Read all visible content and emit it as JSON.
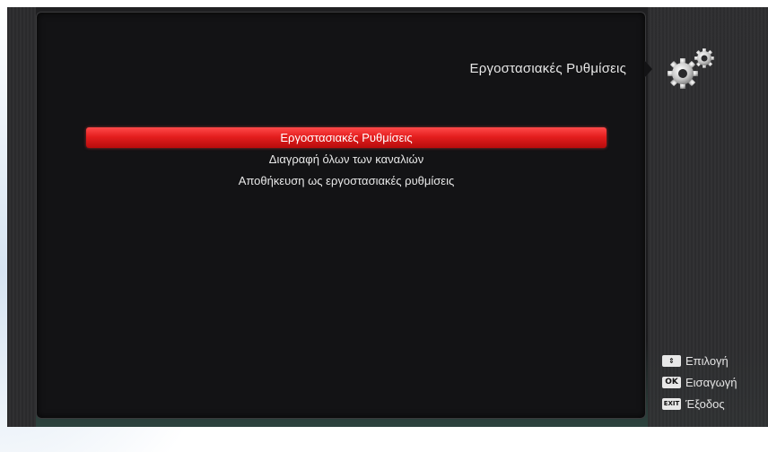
{
  "header": {
    "title": "Εργοστασιακές Ρυθμίσεις",
    "icon": "gears-icon"
  },
  "menu": {
    "items": [
      {
        "label": "Εργοστασιακές Ρυθμίσεις",
        "selected": true
      },
      {
        "label": "Διαγραφή όλων των καναλιών",
        "selected": false
      },
      {
        "label": "Αποθήκευση ως εργοστασιακές ρυθμίσεις",
        "selected": false
      }
    ]
  },
  "help": {
    "select_key": "⇕",
    "select_label": "Επιλογή",
    "ok_key": "OK",
    "ok_label": "Εισαγωγή",
    "exit_key": "EXIT",
    "exit_label": "Έξοδος"
  },
  "colors": {
    "highlight": "#e41e1e",
    "panel": "#131315",
    "text": "#e8e8e8"
  }
}
